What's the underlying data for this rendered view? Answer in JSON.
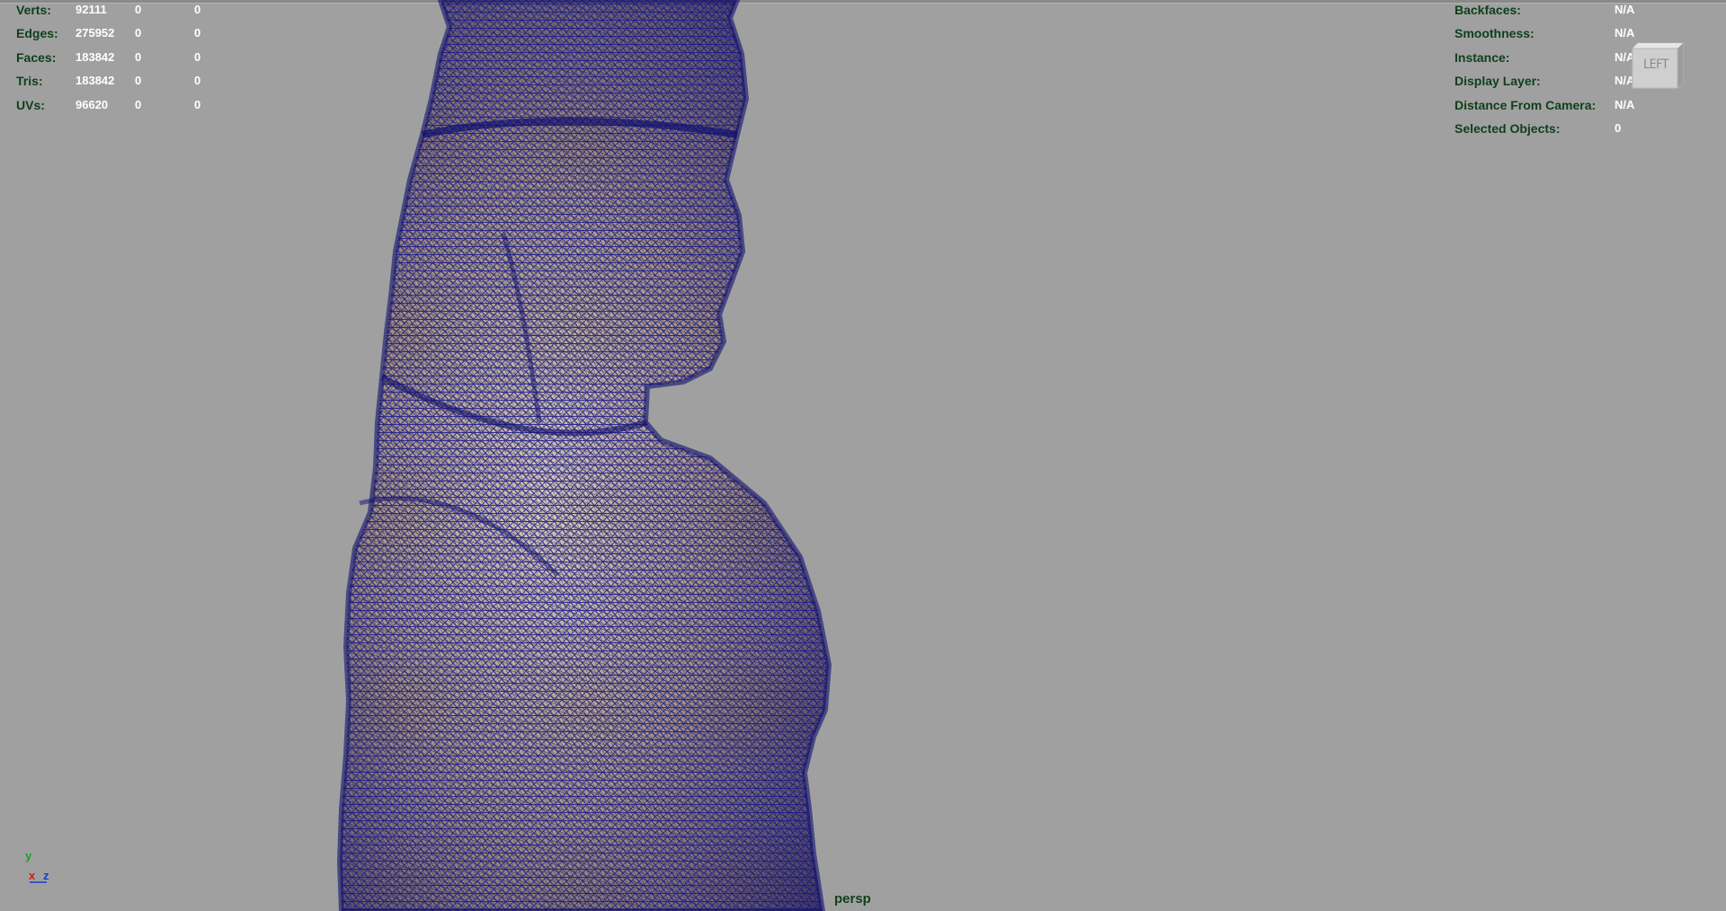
{
  "hud_left": {
    "rows": [
      {
        "label": "Verts:",
        "values": [
          "92111",
          "0",
          "0"
        ]
      },
      {
        "label": "Edges:",
        "values": [
          "275952",
          "0",
          "0"
        ]
      },
      {
        "label": "Faces:",
        "values": [
          "183842",
          "0",
          "0"
        ]
      },
      {
        "label": "Tris:",
        "values": [
          "183842",
          "0",
          "0"
        ]
      },
      {
        "label": "UVs:",
        "values": [
          "96620",
          "0",
          "0"
        ]
      }
    ]
  },
  "hud_right": {
    "rows": [
      {
        "label": "Backfaces:",
        "value": "N/A"
      },
      {
        "label": "Smoothness:",
        "value": "N/A"
      },
      {
        "label": "Instance:",
        "value": "N/A"
      },
      {
        "label": "Display Layer:",
        "value": "N/A"
      },
      {
        "label": "Distance From Camera:",
        "value": "N/A"
      },
      {
        "label": "Selected Objects:",
        "value": "0"
      }
    ]
  },
  "view_cube": {
    "label": "LEFT"
  },
  "axis": {
    "y": "y",
    "x": "x",
    "z": "z"
  },
  "camera": {
    "name": "persp"
  },
  "colors": {
    "viewport_bg": "#a0a0a0",
    "wireframe": "#1a1a8c",
    "shade": "#b8a896",
    "hud_label": "#0f3f1a",
    "hud_value": "#ffffff"
  },
  "icons": {
    "view_cube": "view-cube-icon",
    "axis": "axis-gizmo-icon"
  }
}
